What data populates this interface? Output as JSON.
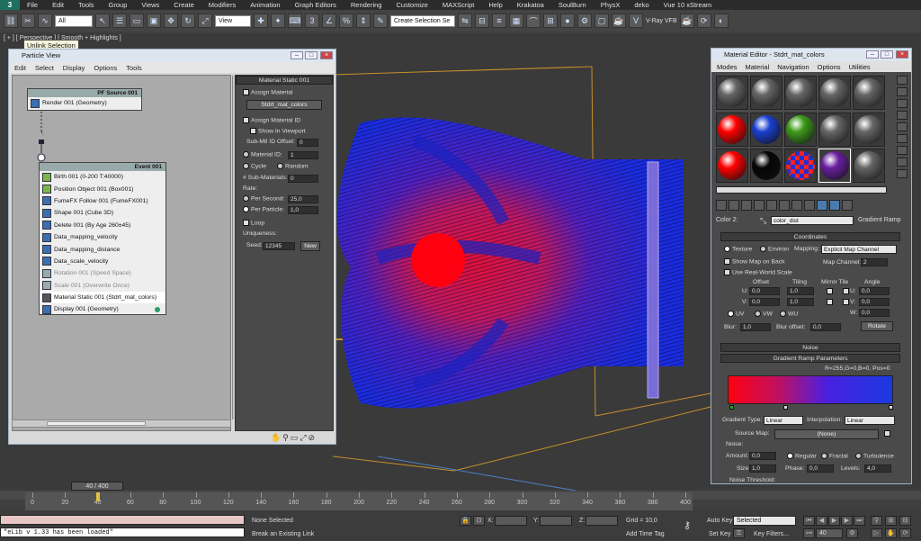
{
  "app": {
    "logo": "3",
    "menu": [
      "File",
      "Edit",
      "Tools",
      "Group",
      "Views",
      "Create",
      "Modifiers",
      "Animation",
      "Graph Editors",
      "Rendering",
      "Customize",
      "MAXScript",
      "Help",
      "Krakatoa",
      "SoulBurn",
      "PhysX",
      "deko",
      "Vue 10 xStream"
    ]
  },
  "toolbar": {
    "selection_filter": "All",
    "reference_coord": "View",
    "named_selection": "Create Selection Se",
    "vray_label": "V-Ray VFB"
  },
  "viewport": {
    "label": "[ + ] [ Perspective ] [ Smooth + Highlights ]",
    "tooltip": "Unlink Selection"
  },
  "particle_view": {
    "title": "Particle View",
    "menu": [
      "Edit",
      "Select",
      "Display",
      "Options",
      "Tools"
    ],
    "source_node": {
      "header": "PF Source 001",
      "rows": [
        "Render 001 (Geometry)"
      ]
    },
    "event_node": {
      "header": "Event 001",
      "rows": [
        {
          "label": "Birth 001 (0-200 T:40000)",
          "color": "#7ab648"
        },
        {
          "label": "Position Object 001 (Box001)",
          "color": "#7ab648"
        },
        {
          "label": "FumeFX Follow 001 (FumeFX001)",
          "color": "#3a6fb0"
        },
        {
          "label": "Shape 001 (Cube 3D)",
          "color": "#3a6fb0"
        },
        {
          "label": "Delete 001 (By Age 260±45)",
          "color": "#3a6fb0"
        },
        {
          "label": "Data_mapping_velocity",
          "color": "#3a6fb0"
        },
        {
          "label": "Data_mapping_distance",
          "color": "#3a6fb0"
        },
        {
          "label": "Data_scale_velocity",
          "color": "#3a6fb0"
        },
        {
          "label": "Rotation 001 (Speed Space)",
          "color": "#9aa",
          "dim": true
        },
        {
          "label": "Scale 001 (Overwrite Once)",
          "color": "#9aa",
          "dim": true
        },
        {
          "label": "Material Static 001 (Stdrt_mat_colors)",
          "color": "#555",
          "selected": true
        },
        {
          "label": "Display 001 (Geometry)",
          "color": "#3a6fb0"
        }
      ]
    },
    "params": {
      "rollout": "Material Static 001",
      "assign_material": "Assign Material",
      "material_button": "Stdrt_mat_colors",
      "assign_material_id": "Assign Material ID",
      "show_in_viewport": "Show In Viewport",
      "sub_mtl_id_offset": "Sub-Mtl ID Offset:",
      "sub_mtl_id_offset_value": "0",
      "material_id": "Material ID:",
      "material_id_value": "1",
      "cycle": "Cycle",
      "random": "Random",
      "num_sub_materials": "# Sub-Materials:",
      "num_sub_materials_value": "0",
      "rate": "Rate:",
      "per_second": "Per Second:",
      "per_second_value": "25,0",
      "per_particle": "Per Particle:",
      "per_particle_value": "1,0",
      "loop": "Loop",
      "uniqueness": "Uniqueness:",
      "seed": "Seed:",
      "seed_value": "12345",
      "new_button": "New"
    }
  },
  "material_editor": {
    "title": "Material Editor - Stdrt_mat_colors",
    "menu": [
      "Modes",
      "Material",
      "Navigation",
      "Options",
      "Utilities"
    ],
    "slots": [
      "#666",
      "#666",
      "#666",
      "#666",
      "#666",
      "#ff0000",
      "#1a3fd0",
      "#3d9a1a",
      "#666",
      "#666",
      "#ff0000",
      "#050505",
      "#c03070",
      "#6a1fa0",
      "#666"
    ],
    "color_label": "Color 2:",
    "map_name": "color_dist",
    "map_type": "Gradient Ramp",
    "coordinates": {
      "header": "Coordinates",
      "texture": "Texture",
      "environ": "Environ",
      "mapping_label": "Mapping:",
      "mapping_value": "Explicit Map Channel",
      "show_map_on_back": "Show Map on Back",
      "map_channel": "Map Channel:",
      "map_channel_value": "2",
      "real_world": "Use Real-World Scale",
      "offset": "Offset",
      "tiling": "Tiling",
      "mirror_tile": "Mirror Tile",
      "angle": "Angle",
      "u": "U:",
      "v": "V:",
      "w": "W:",
      "u_offset": "0,0",
      "v_offset": "0,0",
      "u_tiling": "1,0",
      "v_tiling": "1,0",
      "u_angle": "0,0",
      "v_angle": "0,0",
      "w_angle": "0,0",
      "uv": "UV",
      "vw": "VW",
      "wu": "WU",
      "blur": "Blur:",
      "blur_value": "1,0",
      "blur_offset": "Blur offset:",
      "blur_offset_value": "0,0",
      "rotate": "Rotate"
    },
    "noise_header": "Noise",
    "gradient": {
      "header": "Gradient Ramp Parameters",
      "readout": "R=255,G=0,B=0, Pos=0",
      "gradient_type": "Gradient Type:",
      "gradient_type_value": "Linear",
      "interpolation": "Interpolation:",
      "interpolation_value": "Linear",
      "source_map": "Source Map:",
      "source_map_value": "(None)",
      "noise": "Noise:",
      "amount": "Amount:",
      "amount_value": "0,0",
      "regular": "Regular",
      "fractal": "Fractal",
      "turbulence": "Turbulence",
      "size": "Size:",
      "size_value": "1,0",
      "phase": "Phase:",
      "phase_value": "0,0",
      "levels": "Levels:",
      "levels_value": "4,0",
      "noise_threshold": "Noise Threshold:"
    }
  },
  "timeline": {
    "frame": "40 / 400",
    "ticks": [
      "0",
      "20",
      "40",
      "60",
      "80",
      "100",
      "120",
      "140",
      "160",
      "180",
      "200",
      "220",
      "240",
      "260",
      "280",
      "300",
      "320",
      "340",
      "360",
      "380",
      "400"
    ]
  },
  "status": {
    "script_line": "\"eLib v 1.33 has been loaded\"",
    "selection": "None Selected",
    "prompt": "Break an Existing Link",
    "x_label": "X:",
    "y_label": "Y:",
    "z_label": "Z:",
    "grid": "Grid = 10,0",
    "add_time_tag": "Add Time Tag",
    "auto_key": "Auto Key",
    "auto_key_value": "Selected",
    "set_key": "Set Key",
    "key_filters": "Key Filters...",
    "current_frame": "40"
  }
}
